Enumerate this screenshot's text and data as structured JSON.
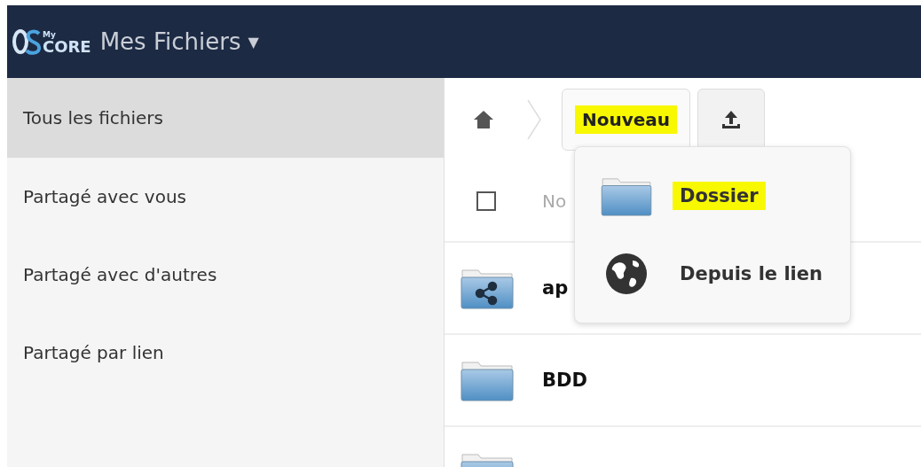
{
  "header": {
    "logo": {
      "small": "My",
      "main": "CORE"
    },
    "title": "Mes Fichiers",
    "caret": "▼"
  },
  "sidebar": {
    "items": [
      {
        "label": "Tous les fichiers",
        "selected": true
      },
      {
        "label": "Partagé avec vous",
        "selected": false
      },
      {
        "label": "Partagé avec d'autres",
        "selected": false
      },
      {
        "label": "Partagé par lien",
        "selected": false
      }
    ]
  },
  "toolbar": {
    "new_button": {
      "label": "Nouveau",
      "highlighted": true
    }
  },
  "new_menu": {
    "items": [
      {
        "kind": "folder",
        "label": "Dossier",
        "highlighted": true
      },
      {
        "kind": "link",
        "label": "Depuis le lien",
        "highlighted": false
      }
    ]
  },
  "table": {
    "select_all": {
      "checked": false
    },
    "columns": [
      "No"
    ],
    "rows": [
      {
        "kind": "shared",
        "name": "ap"
      },
      {
        "kind": "folder",
        "name": "BDD"
      },
      {
        "kind": "folder"
      }
    ]
  }
}
